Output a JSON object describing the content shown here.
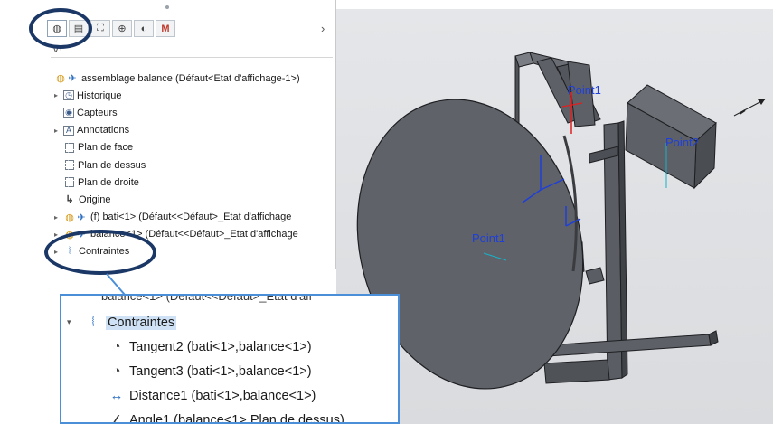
{
  "tabs": [
    {
      "icon": "assembly-icon",
      "glyph": "◍",
      "active": true
    },
    {
      "icon": "property-manager-icon",
      "glyph": "▤",
      "active": false
    },
    {
      "icon": "configuration-manager-icon",
      "glyph": "⛶",
      "active": false
    },
    {
      "icon": "dimxpert-icon",
      "glyph": "⊕",
      "active": false
    },
    {
      "icon": "display-manager-icon",
      "glyph": "◐",
      "active": false
    },
    {
      "icon": "m-addin-icon",
      "glyph": "M",
      "active": false
    }
  ],
  "tab_overflow_glyph": "›",
  "filter_glyph": "∀·",
  "tree": {
    "root": "assemblage balance  (Défaut<Etat d'affichage-1>)",
    "items": [
      {
        "label": "Historique",
        "expandable": true,
        "icon": "history-icon",
        "glyph": "◷"
      },
      {
        "label": "Capteurs",
        "expandable": false,
        "icon": "sensors-icon",
        "glyph": "◉"
      },
      {
        "label": "Annotations",
        "expandable": true,
        "icon": "annotations-icon",
        "glyph": "A"
      },
      {
        "label": "Plan de face",
        "expandable": false,
        "icon": "plane-icon",
        "glyph": ""
      },
      {
        "label": "Plan de dessus",
        "expandable": false,
        "icon": "plane-icon",
        "glyph": ""
      },
      {
        "label": "Plan de droite",
        "expandable": false,
        "icon": "plane-icon",
        "glyph": ""
      },
      {
        "label": "Origine",
        "expandable": false,
        "icon": "origin-icon",
        "glyph": "↳"
      },
      {
        "label": "(f) bati<1> (Défaut<<Défaut>_Etat d'affichage",
        "expandable": true,
        "icon": "part-icon",
        "glyph": "◍"
      },
      {
        "label": "balance<1> (Défaut<<Défaut>_Etat d'affichage",
        "expandable": true,
        "icon": "part-icon",
        "glyph": "◍"
      },
      {
        "label": "Contraintes",
        "expandable": true,
        "icon": "mates-icon",
        "glyph": "⦚"
      }
    ]
  },
  "callout": {
    "prev_text": "balance<1> (Défaut<<Défaut>_Etat d'aff",
    "header": "Contraintes",
    "mates": [
      {
        "label": "Tangent2 (bati<1>,balance<1>)",
        "icon": "tangent-mate-icon",
        "glyph": "◔"
      },
      {
        "label": "Tangent3 (bati<1>,balance<1>)",
        "icon": "tangent-mate-icon",
        "glyph": "◔"
      },
      {
        "label": "Distance1 (bati<1>,balance<1>)",
        "icon": "distance-mate-icon",
        "glyph": "↔"
      },
      {
        "label": "Angle1 (balance<1>,Plan de dessus)",
        "icon": "angle-mate-icon",
        "glyph": "∠"
      }
    ]
  },
  "viewport": {
    "labels": {
      "point1_top": "Point1",
      "point2": "Point2",
      "point1_disc": "Point1"
    },
    "colors": {
      "part": "#5d6066",
      "part_edge": "#1e1f22",
      "axis_blue": "#1f3fd8",
      "axis_red": "#e02020",
      "annotation": "#1b3766"
    }
  }
}
